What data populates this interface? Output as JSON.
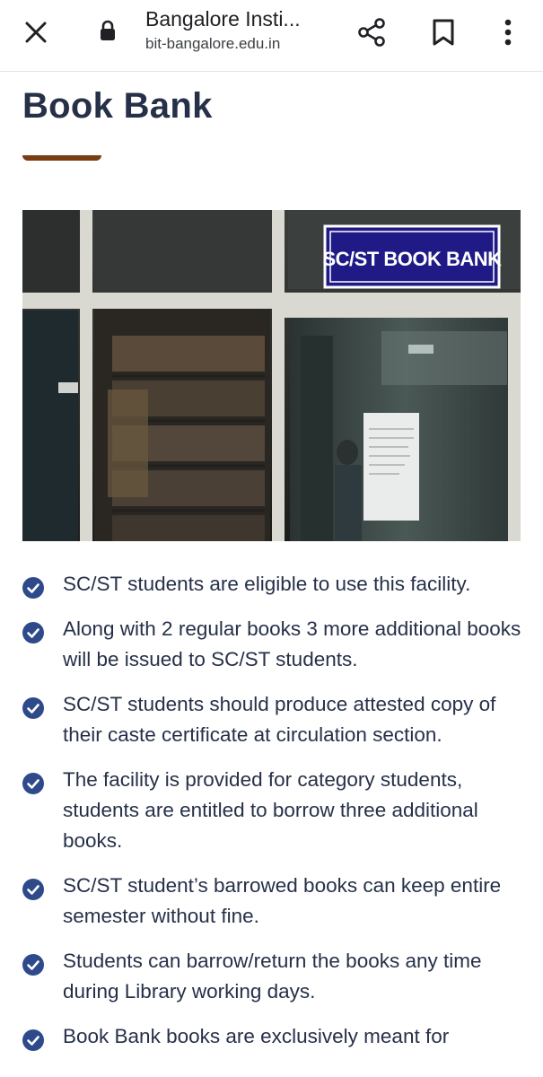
{
  "browser": {
    "page_title": "Bangalore Insti...",
    "url": "bit-bangalore.edu.in",
    "icons": [
      "close-icon",
      "lock-icon",
      "share-icon",
      "bookmark-icon",
      "more-vert-icon"
    ]
  },
  "page": {
    "heading": "Book Bank",
    "image": {
      "sign_text": "SC/ST BOOK BANK"
    },
    "features": [
      "SC/ST students are eligible to use this facility.",
      "Along with 2 regular books 3 more additional books will be issued to SC/ST students.",
      "SC/ST students should produce attested copy of their caste certificate at circulation section.",
      "The facility is provided for category students, students are entitled to borrow three additional books.",
      "SC/ST student’s barrowed books can keep entire semester without fine.",
      "Students can barrow/return the books any time during Library working days.",
      "Book Bank books are exclusively meant for"
    ]
  },
  "colors": {
    "heading": "#263048",
    "accent_underline": "#7a3d12",
    "check_icon": "#2f4a8a",
    "sign_bg": "#1f1a86"
  }
}
